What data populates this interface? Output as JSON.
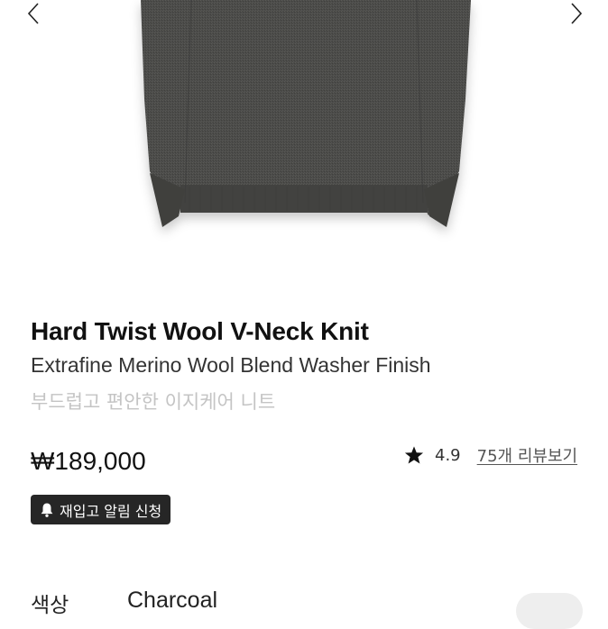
{
  "product": {
    "title": "Hard Twist Wool V-Neck Knit",
    "subtitle": "Extrafine Merino Wool Blend Washer Finish",
    "description": "부드럽고 편안한 이지케어 니트",
    "price": "₩189,000",
    "image_alt": "charcoal sweater"
  },
  "rating": {
    "icon": "star-icon",
    "value": "4.9",
    "review_link": "75개 리뷰보기"
  },
  "restock": {
    "icon": "bell-icon",
    "label": "재입고 알림 신청"
  },
  "options": {
    "color_label": "색상",
    "color_value": "Charcoal"
  },
  "colors": {
    "text": "#111111",
    "muted": "#c4c4c4",
    "button_bg": "#262626",
    "sweater": "#4a4a48"
  }
}
